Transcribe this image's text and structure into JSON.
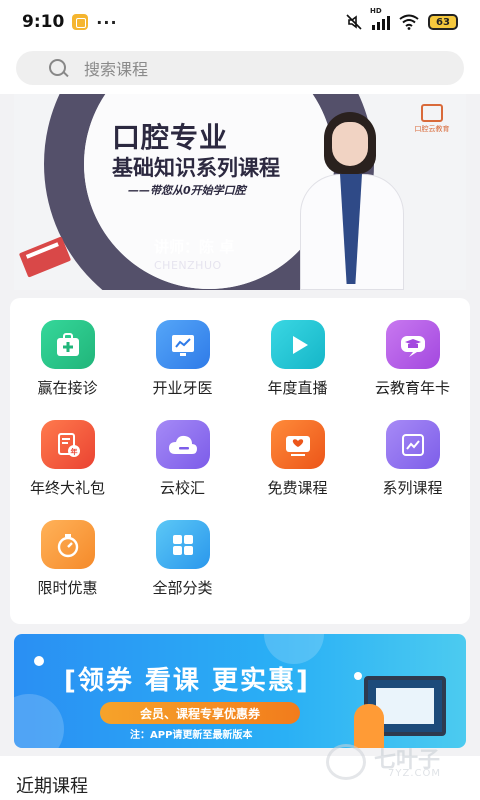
{
  "status_bar": {
    "time": "9:10",
    "dots": "···",
    "network_label": "HD",
    "battery": "63"
  },
  "search": {
    "placeholder": "搜索课程"
  },
  "banner": {
    "title": "口腔专业",
    "subtitle": "基础知识系列课程",
    "tagline": "——带您从0开始学口腔",
    "teacher": "讲师：陈 卓",
    "teacher_en": "CHENZHUO",
    "logo_text": "口腔云教育"
  },
  "grid": {
    "items": [
      {
        "label": "赢在接诊",
        "icon": "medical-kit-icon",
        "color": "#2fc98c"
      },
      {
        "label": "开业牙医",
        "icon": "monitor-chart-icon",
        "color": "#3b8ff1"
      },
      {
        "label": "年度直播",
        "icon": "play-icon",
        "color": "#1ec6d6"
      },
      {
        "label": "云教育年卡",
        "icon": "graduation-cap-icon",
        "color": "#b65ae6"
      },
      {
        "label": "年终大礼包",
        "icon": "gift-document-icon",
        "color": "#f35b3a"
      },
      {
        "label": "云校汇",
        "icon": "cloud-icon",
        "color": "#8c6ff0"
      },
      {
        "label": "免费课程",
        "icon": "free-ticket-icon",
        "color": "#f36a2a"
      },
      {
        "label": "系列课程",
        "icon": "series-chart-icon",
        "color": "#8f6ff0"
      },
      {
        "label": "限时优惠",
        "icon": "stopwatch-icon",
        "color": "#f59a3a"
      },
      {
        "label": "全部分类",
        "icon": "grid-categories-icon",
        "color": "#3fb2f2"
      }
    ]
  },
  "promo": {
    "headline": "[领券  看课  更实惠]",
    "pill": "会员、课程专享优惠券",
    "note": "注：APP请更新至最新版本"
  },
  "watermark": {
    "text": "七叶子",
    "sub": "7YZ.COM"
  },
  "section": {
    "title": "近期课程"
  }
}
